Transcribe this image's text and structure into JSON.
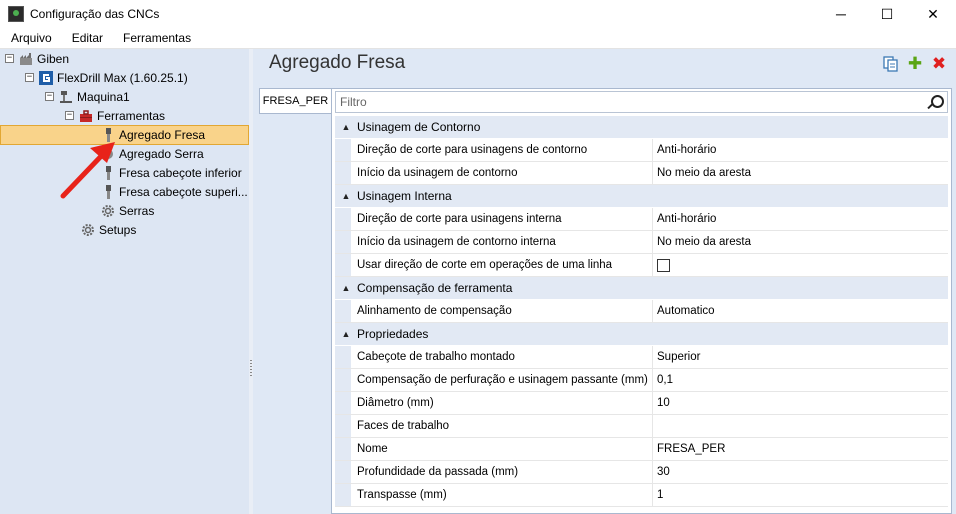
{
  "window": {
    "title": "Configuração das CNCs",
    "controls": {
      "minimize": "─",
      "maximize": "☐",
      "close": "✕"
    }
  },
  "menu": [
    "Arquivo",
    "Editar",
    "Ferramentas"
  ],
  "tree": {
    "root": "Giben",
    "machine_group": "FlexDrill Max (1.60.25.1)",
    "machine": "Maquina1",
    "tools_folder": "Ferramentas",
    "tools": [
      "Agregado Fresa",
      "Agregado Serra",
      "Fresa cabeçote inferior",
      "Fresa cabeçote superi..."
    ],
    "saws": "Serras",
    "setups": "Setups",
    "expander_symbol": "−"
  },
  "panel": {
    "title": "Agregado Fresa",
    "tab": "FRESA_PER",
    "filter_placeholder": "Filtro",
    "icons": [
      "copy-icon",
      "add-icon",
      "delete-icon"
    ],
    "icon_glyphs": {
      "add": "✚",
      "delete": "✖"
    },
    "collapse_glyph": "▲"
  },
  "categories": [
    {
      "name": "Usinagem de Contorno",
      "rows": [
        {
          "label": "Direção de corte para usinagens de contorno",
          "value": "Anti-horário"
        },
        {
          "label": "Início da usinagem de contorno",
          "value": "No meio da aresta"
        }
      ]
    },
    {
      "name": "Usinagem Interna",
      "rows": [
        {
          "label": "Direção de corte para usinagens interna",
          "value": "Anti-horário"
        },
        {
          "label": "Início da usinagem de contorno interna",
          "value": "No meio da aresta"
        },
        {
          "label": "Usar direção de corte em operações de uma linha",
          "value": "",
          "checkbox": false
        }
      ]
    },
    {
      "name": "Compensação de ferramenta",
      "rows": [
        {
          "label": "Alinhamento de compensação",
          "value": "Automatico"
        }
      ]
    },
    {
      "name": "Propriedades",
      "rows": [
        {
          "label": "Cabeçote de trabalho montado",
          "value": "Superior"
        },
        {
          "label": "Compensação de perfuração e usinagem passante (mm)",
          "value": "0,1"
        },
        {
          "label": "Diâmetro (mm)",
          "value": "10"
        },
        {
          "label": "Faces de trabalho",
          "value": ""
        },
        {
          "label": "Nome",
          "value": "FRESA_PER"
        },
        {
          "label": "Profundidade da passada (mm)",
          "value": "30"
        },
        {
          "label": "Transpasse (mm)",
          "value": "1"
        }
      ]
    }
  ],
  "colors": {
    "tree_background": "#dde6f3",
    "selection": "#f9d38a",
    "category_background": "#e2e9f4",
    "annotation_arrow": "#e8231a"
  }
}
